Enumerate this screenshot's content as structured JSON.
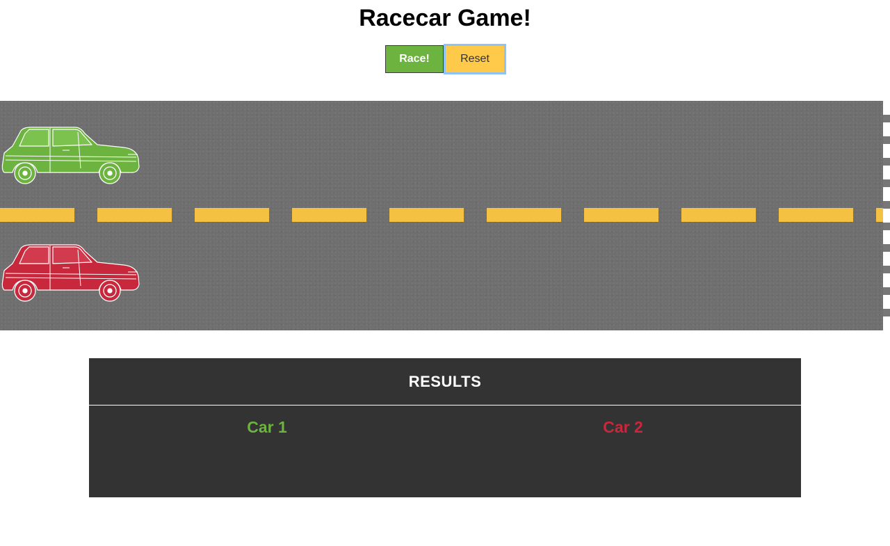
{
  "header": {
    "title": "Racecar Game!"
  },
  "controls": {
    "race_label": "Race!",
    "reset_label": "Reset"
  },
  "track": {
    "lane_divider_color": "#f5c142",
    "asphalt_color": "#6f6f6f",
    "cars": [
      {
        "name": "car-1",
        "color": "#6db33f",
        "icon": "green-car-icon"
      },
      {
        "name": "car-2",
        "color": "#c8283c",
        "icon": "red-car-icon"
      }
    ]
  },
  "results": {
    "heading": "RESULTS",
    "columns": [
      {
        "label": "Car 1",
        "color": "#6db33f"
      },
      {
        "label": "Car 2",
        "color": "#c8283c"
      }
    ]
  }
}
